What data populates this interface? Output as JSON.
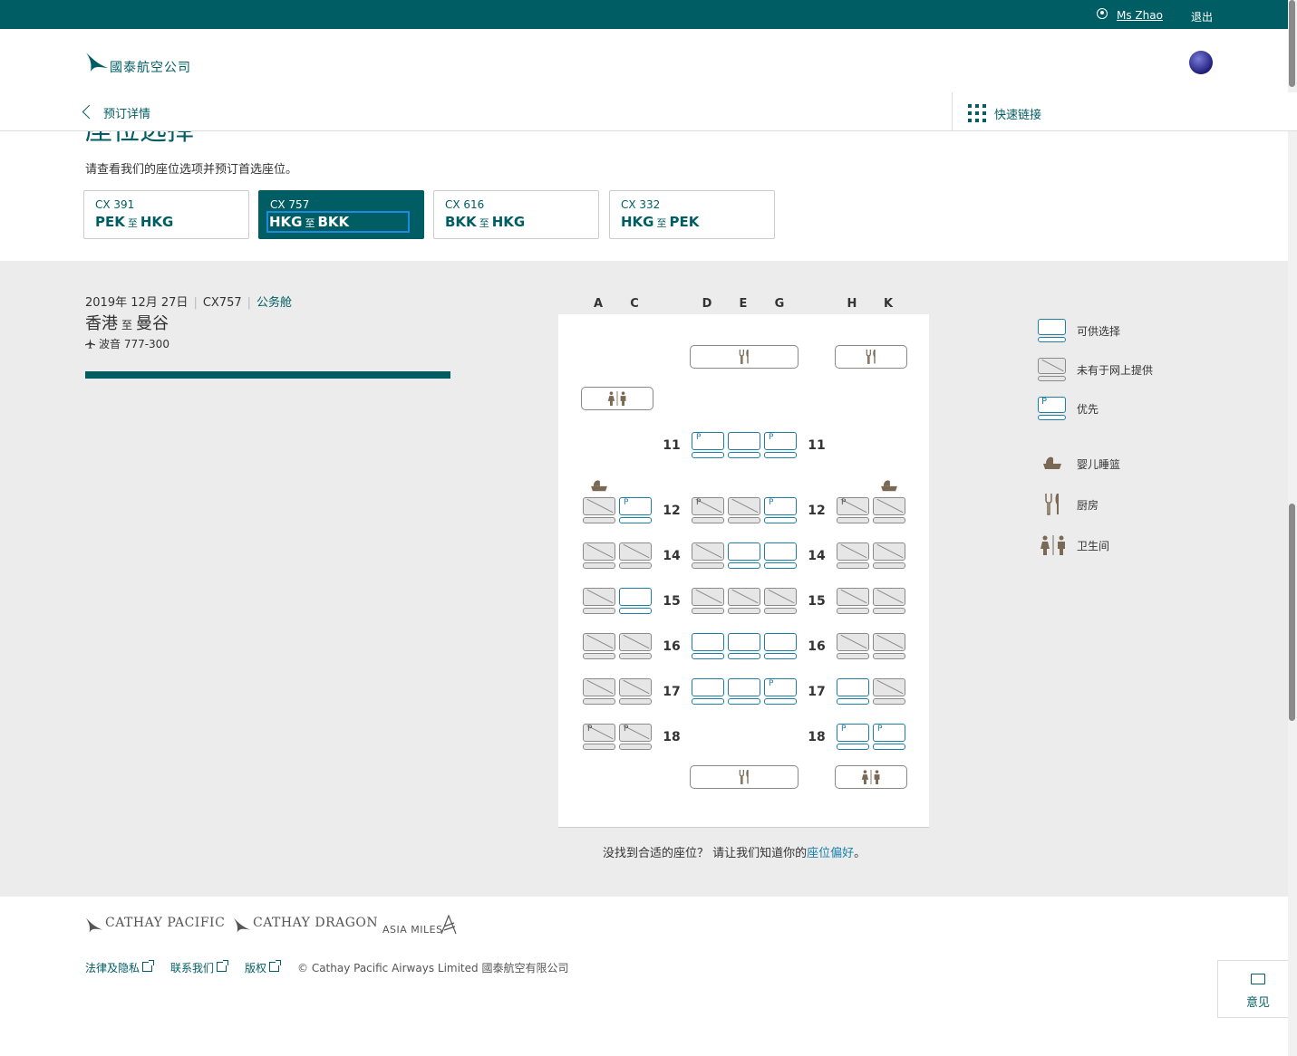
{
  "topbar": {
    "user_name": "Ms Zhao",
    "logout": "退出"
  },
  "header": {
    "logo_text": "國泰航空公司"
  },
  "subnav": {
    "back_label": "预订详情",
    "quick_links": "快速链接"
  },
  "page": {
    "title": "座位选择",
    "subtitle": "请查看我们的座位选项并预订首选座位。"
  },
  "flights": [
    {
      "no": "CX 391",
      "from": "PEK",
      "to_word": "至",
      "to": "HKG"
    },
    {
      "no": "CX 757",
      "from": "HKG",
      "to_word": "至",
      "to": "BKK"
    },
    {
      "no": "CX 616",
      "from": "BKK",
      "to_word": "至",
      "to": "HKG"
    },
    {
      "no": "CX 332",
      "from": "HKG",
      "to_word": "至",
      "to": "PEK"
    }
  ],
  "active_flight": 1,
  "flight_info": {
    "date": "2019年 12月 27日",
    "flight_no": "CX757",
    "cabin": "公务舱",
    "from_city": "香港",
    "to_word": "至",
    "to_city": "曼谷",
    "aircraft": "波音 777-300"
  },
  "columns": [
    "A",
    "C",
    "D",
    "E",
    "G",
    "H",
    "K"
  ],
  "rows": [
    {
      "row": "11",
      "seats": {
        "D": "priority",
        "E": "available",
        "G": "priority"
      }
    },
    {
      "row": "12",
      "seats": {
        "A": "unavailable",
        "C": "priority",
        "D": "unavailable-p",
        "E": "unavailable",
        "G": "priority",
        "H": "unavailable-p",
        "K": "unavailable"
      }
    },
    {
      "row": "14",
      "seats": {
        "A": "unavailable",
        "C": "unavailable",
        "D": "unavailable",
        "E": "available",
        "G": "available",
        "H": "unavailable",
        "K": "unavailable"
      }
    },
    {
      "row": "15",
      "seats": {
        "A": "unavailable",
        "C": "available",
        "D": "unavailable",
        "E": "unavailable",
        "G": "unavailable",
        "H": "unavailable",
        "K": "unavailable"
      }
    },
    {
      "row": "16",
      "seats": {
        "A": "unavailable",
        "C": "unavailable",
        "D": "available",
        "E": "available",
        "G": "available",
        "H": "unavailable",
        "K": "unavailable"
      }
    },
    {
      "row": "17",
      "seats": {
        "A": "unavailable",
        "C": "unavailable",
        "D": "available",
        "E": "available",
        "G": "priority",
        "H": "available",
        "K": "unavailable"
      }
    },
    {
      "row": "18",
      "seats": {
        "A": "unavailable-p",
        "C": "unavailable-p",
        "H": "priority",
        "K": "priority"
      }
    }
  ],
  "seat_marker": "P",
  "legend": {
    "available": "可供选择",
    "unavailable": "未有于网上提供",
    "priority": "优先",
    "bassinet": "婴儿睡篮",
    "galley": "厨房",
    "lavatory": "卫生间"
  },
  "seat_note": {
    "prefix": "没找到合适的座位？ 请让我们知道你的",
    "link": "座位偏好",
    "suffix": "。"
  },
  "footer": {
    "brand1": "CATHAY PACIFIC",
    "brand2": "CATHAY DRAGON",
    "brand3": "ASIA MILES",
    "links": [
      "法律及隐私",
      "联系我们",
      "版权"
    ],
    "copyright": "© Cathay Pacific Airways Limited 國泰航空有限公司",
    "feedback": "意见"
  },
  "colors": {
    "brand": "#005d63",
    "seat_available": "#1b7fa8",
    "seat_unavailable": "#8a8a8a"
  }
}
